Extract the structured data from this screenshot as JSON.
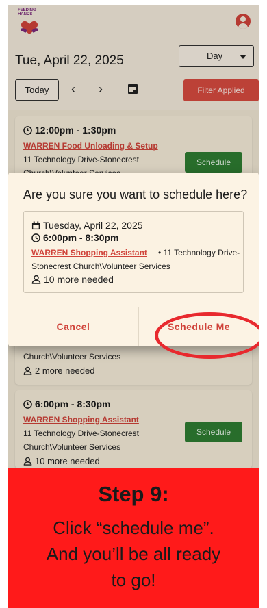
{
  "app": {
    "logo_text_line1": "FEEDING",
    "logo_text_line2": "HANDS",
    "date_title": "Tue, April 22, 2025",
    "view_select": "Day",
    "today_label": "Today",
    "prev_label": "‹",
    "next_label": "›",
    "filter_label": "Filter Applied"
  },
  "shifts": [
    {
      "time": "12:00pm - 1:30pm",
      "role": "WARREN Food Unloading & Setup",
      "location_line1": "11 Technology Drive-Stonecrest",
      "location_line2": "Church\\Volunteer Services",
      "button": "Schedule"
    },
    {
      "location_line2": "Church\\Volunteer Services",
      "needed": "2 more needed"
    },
    {
      "time": "6:00pm - 8:30pm",
      "role": "WARREN Shopping Assistant",
      "location_line1": "11 Technology Drive-Stonecrest",
      "location_line2": "Church\\Volunteer Services",
      "needed": "10 more needed",
      "button": "Schedule"
    }
  ],
  "modal": {
    "title": "Are you sure you want to schedule here?",
    "date": "Tuesday, April 22, 2025",
    "time": "6:00pm - 8:30pm",
    "role": "WARREN Shopping Assistant",
    "separator": "•",
    "location_line1": "11 Technology Drive-",
    "location_line2": "Stonecrest Church\\Volunteer Services",
    "needed": "10 more needed",
    "cancel": "Cancel",
    "confirm": "Schedule Me"
  },
  "banner": {
    "title": "Step 9:",
    "line1": "Click “schedule me”.",
    "line2": "And you’ll be all ready",
    "line3": "to go!"
  },
  "colors": {
    "accent_red": "#d0433a",
    "schedule_green": "#2e7d32",
    "banner_red": "#ff1a1a",
    "ring_red": "#e8292e"
  }
}
